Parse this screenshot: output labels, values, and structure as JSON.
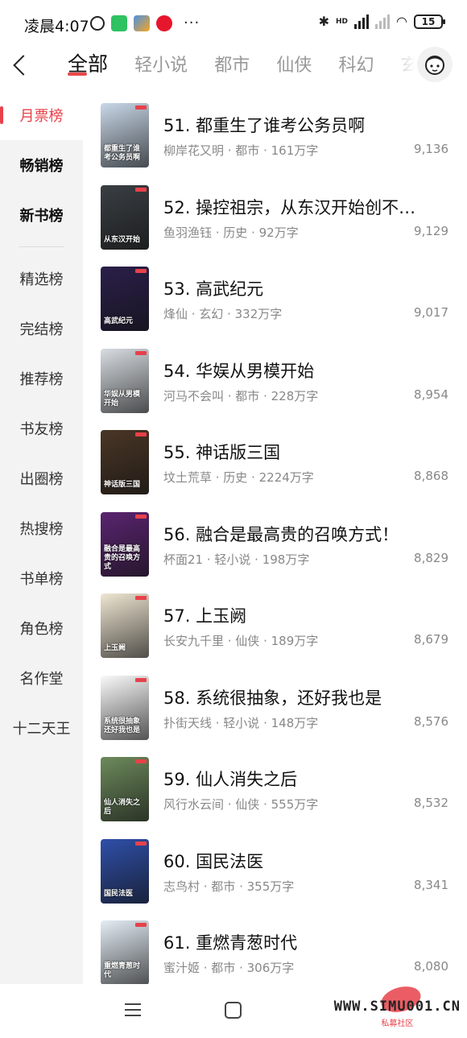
{
  "status_bar": {
    "time": "凌晨4:07",
    "dots": "···",
    "hd": "HD",
    "battery": "15"
  },
  "top_nav": {
    "tabs": [
      "全部",
      "轻小说",
      "都市",
      "仙侠",
      "科幻",
      "玄幻"
    ],
    "active_tab": 0
  },
  "sidebar": {
    "items": [
      "月票榜",
      "畅销榜",
      "新书榜",
      "精选榜",
      "完结榜",
      "推荐榜",
      "书友榜",
      "出圈榜",
      "热搜榜",
      "书单榜",
      "角色榜",
      "名作堂",
      "十二天王"
    ]
  },
  "books": [
    {
      "title": "51. 都重生了谁考公务员啊",
      "meta": "柳岸花又明 · 都市 · 161万字",
      "votes": "9,136",
      "cover_text": "都重生了谁考公务员啊",
      "cover_bg": "#c9d8e8"
    },
    {
      "title": "52. 操控祖宗，从东汉开始创不…",
      "meta": "鱼羽渔钰 · 历史 · 92万字",
      "votes": "9,129",
      "cover_text": "从东汉开始",
      "cover_bg": "#3a3f44"
    },
    {
      "title": "53. 高武纪元",
      "meta": "烽仙 · 玄幻 · 332万字",
      "votes": "9,017",
      "cover_text": "高武纪元",
      "cover_bg": "#2a1f4a"
    },
    {
      "title": "54. 华娱从男模开始",
      "meta": "河马不会叫 · 都市 · 228万字",
      "votes": "8,954",
      "cover_text": "华娱从男模开始",
      "cover_bg": "#d8dde2"
    },
    {
      "title": "55. 神话版三国",
      "meta": "坟土荒草 · 历史 · 2224万字",
      "votes": "8,868",
      "cover_text": "神话版三国",
      "cover_bg": "#4a3626"
    },
    {
      "title": "56. 融合是最高贵的召唤方式！",
      "meta": "杯面21 · 轻小说 · 198万字",
      "votes": "8,829",
      "cover_text": "融合是最高贵的召唤方式",
      "cover_bg": "#5a2470"
    },
    {
      "title": "57. 上玉阙",
      "meta": "长安九千里 · 仙侠 · 189万字",
      "votes": "8,679",
      "cover_text": "上玉阙",
      "cover_bg": "#efe6d2"
    },
    {
      "title": "58. 系统很抽象，还好我也是",
      "meta": "扑街天线 · 轻小说 · 148万字",
      "votes": "8,576",
      "cover_text": "系统很抽象 还好我也是",
      "cover_bg": "#fafafa"
    },
    {
      "title": "59. 仙人消失之后",
      "meta": "风行水云间 · 仙侠 · 555万字",
      "votes": "8,532",
      "cover_text": "仙人消失之后",
      "cover_bg": "#6d8a5c"
    },
    {
      "title": "60. 国民法医",
      "meta": "志鸟村 · 都市 · 355万字",
      "votes": "8,341",
      "cover_text": "国民法医",
      "cover_bg": "#2f4fa8"
    },
    {
      "title": "61. 重燃青葱时代",
      "meta": "蜜汁姬 · 都市 · 306万字",
      "votes": "8,080",
      "cover_text": "重燃青葱时代",
      "cover_bg": "#e4edf5"
    }
  ],
  "watermark": {
    "text": "WWW.SIMU001.CN",
    "sub": "私募社区"
  },
  "colors": {
    "accent": "#e8414a",
    "sidebar_bg": "#f3f3f3"
  }
}
